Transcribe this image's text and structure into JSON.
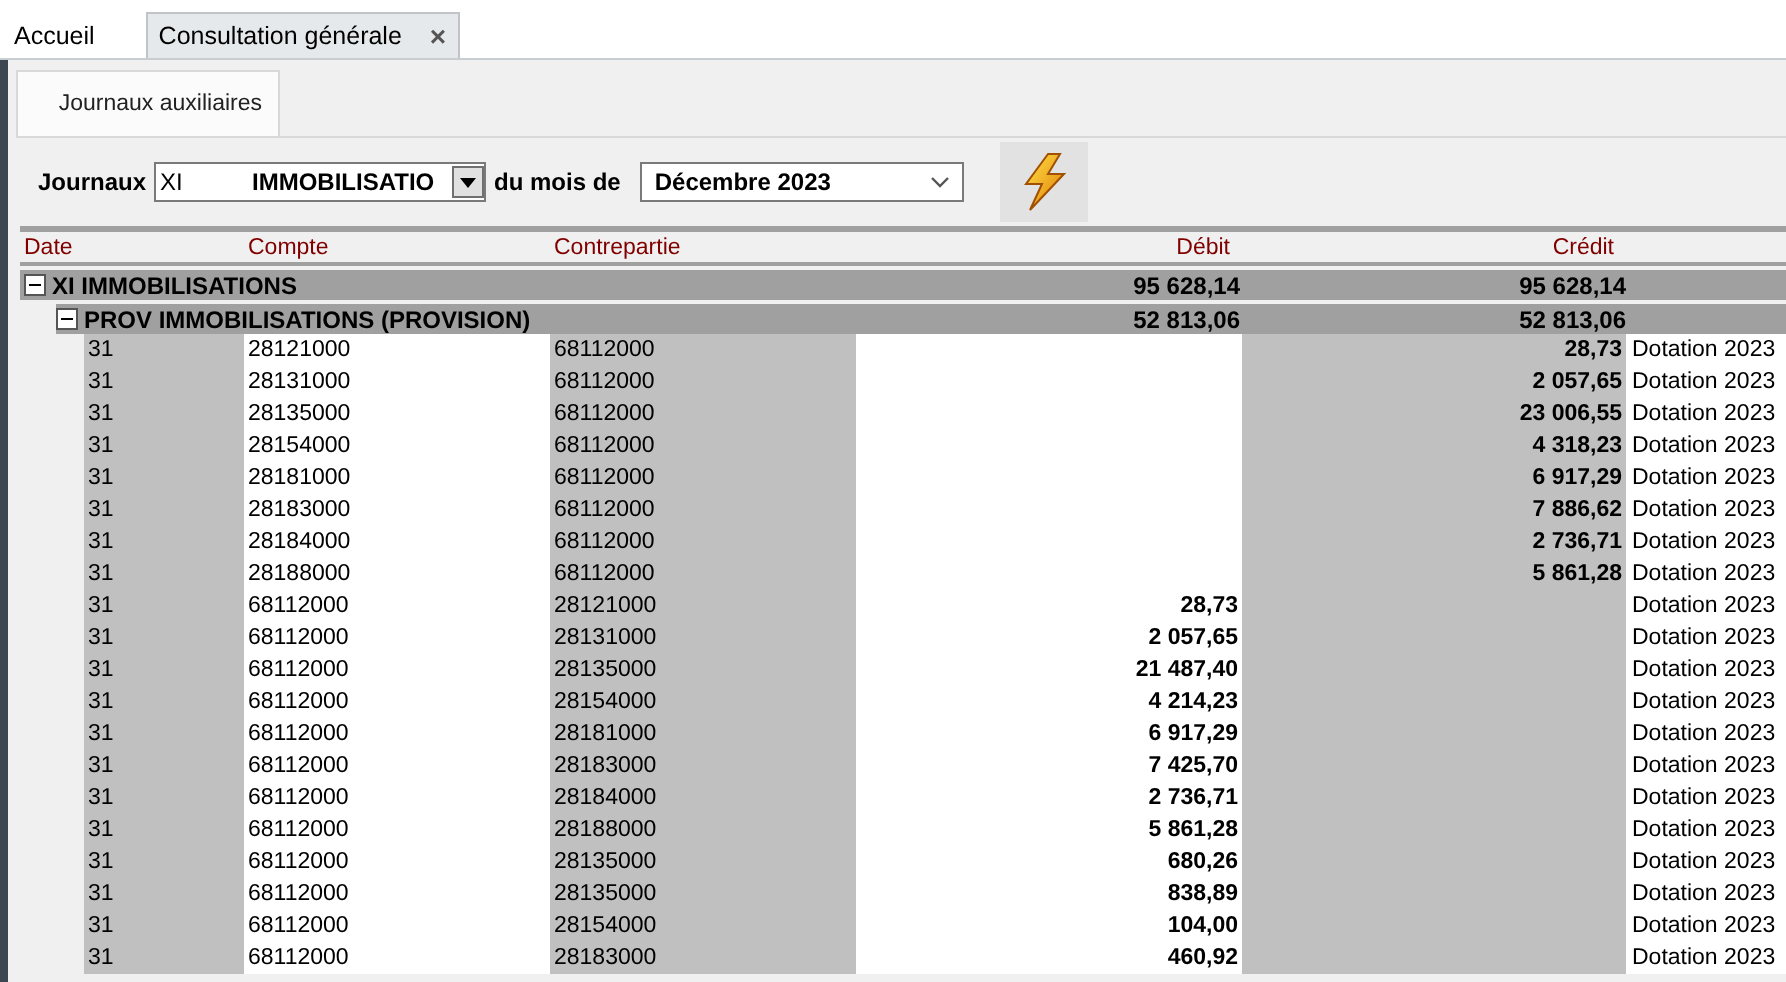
{
  "tabs": [
    {
      "label": "Accueil",
      "selected": false
    },
    {
      "label": "Consultation générale",
      "selected": true,
      "close": "×"
    }
  ],
  "subtabs": [
    {
      "label": "Journaux auxiliaires",
      "selected": true
    }
  ],
  "filter": {
    "journal_label": "Journaux",
    "journal_code": "XI",
    "journal_name": "IMMOBILISATIO",
    "month_label": "du mois de",
    "month_value": "Décembre 2023"
  },
  "grid": {
    "columns": [
      "Date",
      "Compte",
      "Contrepartie",
      "Débit",
      "Crédit"
    ],
    "groups": [
      {
        "label": "XI IMMOBILISATIONS",
        "debit": "95 628,14",
        "credit": "95 628,14",
        "expanded": true,
        "children": [
          {
            "label": "PROV IMMOBILISATIONS (PROVISION)",
            "debit": "52 813,06",
            "credit": "52 813,06",
            "expanded": true,
            "rows": [
              {
                "date": "31",
                "compte": "28121000",
                "contrepartie": "68112000",
                "credit": "28,73",
                "libelle": "Dotation 2023"
              },
              {
                "date": "31",
                "compte": "28131000",
                "contrepartie": "68112000",
                "credit": "2 057,65",
                "libelle": "Dotation 2023"
              },
              {
                "date": "31",
                "compte": "28135000",
                "contrepartie": "68112000",
                "credit": "23 006,55",
                "libelle": "Dotation 2023"
              },
              {
                "date": "31",
                "compte": "28154000",
                "contrepartie": "68112000",
                "credit": "4 318,23",
                "libelle": "Dotation 2023"
              },
              {
                "date": "31",
                "compte": "28181000",
                "contrepartie": "68112000",
                "credit": "6 917,29",
                "libelle": "Dotation 2023"
              },
              {
                "date": "31",
                "compte": "28183000",
                "contrepartie": "68112000",
                "credit": "7 886,62",
                "libelle": "Dotation 2023"
              },
              {
                "date": "31",
                "compte": "28184000",
                "contrepartie": "68112000",
                "credit": "2 736,71",
                "libelle": "Dotation 2023"
              },
              {
                "date": "31",
                "compte": "28188000",
                "contrepartie": "68112000",
                "credit": "5 861,28",
                "libelle": "Dotation 2023"
              },
              {
                "date": "31",
                "compte": "68112000",
                "contrepartie": "28121000",
                "debit": "28,73",
                "libelle": "Dotation 2023"
              },
              {
                "date": "31",
                "compte": "68112000",
                "contrepartie": "28131000",
                "debit": "2 057,65",
                "libelle": "Dotation 2023"
              },
              {
                "date": "31",
                "compte": "68112000",
                "contrepartie": "28135000",
                "debit": "21 487,40",
                "libelle": "Dotation 2023"
              },
              {
                "date": "31",
                "compte": "68112000",
                "contrepartie": "28154000",
                "debit": "4 214,23",
                "libelle": "Dotation 2023"
              },
              {
                "date": "31",
                "compte": "68112000",
                "contrepartie": "28181000",
                "debit": "6 917,29",
                "libelle": "Dotation 2023"
              },
              {
                "date": "31",
                "compte": "68112000",
                "contrepartie": "28183000",
                "debit": "7 425,70",
                "libelle": "Dotation 2023"
              },
              {
                "date": "31",
                "compte": "68112000",
                "contrepartie": "28184000",
                "debit": "2 736,71",
                "libelle": "Dotation 2023"
              },
              {
                "date": "31",
                "compte": "68112000",
                "contrepartie": "28188000",
                "debit": "5 861,28",
                "libelle": "Dotation 2023"
              },
              {
                "date": "31",
                "compte": "68112000",
                "contrepartie": "28135000",
                "debit": "680,26",
                "libelle": "Dotation 2023"
              },
              {
                "date": "31",
                "compte": "68112000",
                "contrepartie": "28135000",
                "debit": "838,89",
                "libelle": "Dotation 2023"
              },
              {
                "date": "31",
                "compte": "68112000",
                "contrepartie": "28154000",
                "debit": "104,00",
                "libelle": "Dotation 2023"
              },
              {
                "date": "31",
                "compte": "68112000",
                "contrepartie": "28183000",
                "debit": "460,92",
                "libelle": "Dotation 2023"
              }
            ]
          }
        ]
      }
    ]
  }
}
